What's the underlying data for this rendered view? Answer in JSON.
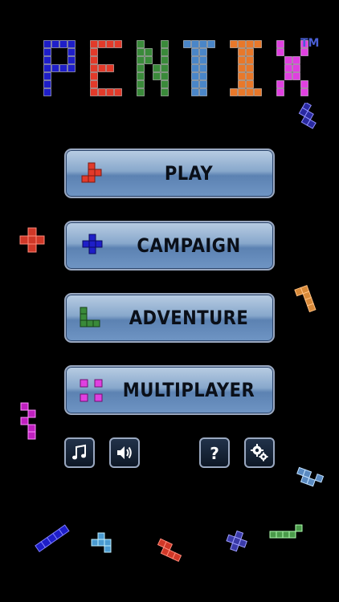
{
  "logo": {
    "text": "PENTIX",
    "trademark": "TM",
    "letter_colors": [
      "#1e1ec8",
      "#e23a2a",
      "#3a8a3a",
      "#4a86c8",
      "#e8782a",
      "#e040e0"
    ]
  },
  "menu": [
    {
      "id": "play",
      "label": "PLAY",
      "piece_color": "#e23a2a"
    },
    {
      "id": "campaign",
      "label": "CAMPAIGN",
      "piece_color": "#1e1ec8"
    },
    {
      "id": "adventure",
      "label": "ADVENTURE",
      "piece_color": "#3a8a3a"
    },
    {
      "id": "multiplayer",
      "label": "MULTIPLAYER",
      "piece_color": "#e040e0"
    }
  ],
  "icons": [
    "music-note-icon",
    "speaker-icon",
    "help-icon",
    "settings-gear-icon"
  ],
  "colors": {
    "background": "#000000",
    "button_border": "#9aa8c0",
    "button_text": "#0a0f18"
  }
}
